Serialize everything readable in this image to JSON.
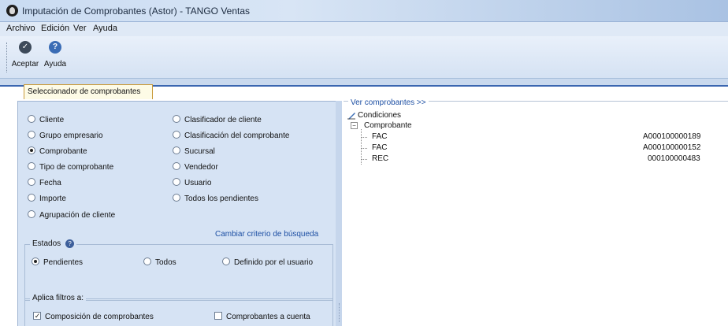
{
  "window": {
    "title": "Imputación de Comprobantes (Astor) - TANGO Ventas"
  },
  "menu": [
    "Archivo",
    "Edición",
    "Ver",
    "Ayuda"
  ],
  "toolbar": {
    "accept_label": "Aceptar",
    "help_label": "Ayuda"
  },
  "tab": {
    "label": "Seleccionador de comprobantes"
  },
  "criteria": {
    "left": [
      {
        "label": "Cliente",
        "selected": false
      },
      {
        "label": "Grupo empresario",
        "selected": false
      },
      {
        "label": "Comprobante",
        "selected": true
      },
      {
        "label": "Tipo de comprobante",
        "selected": false
      },
      {
        "label": "Fecha",
        "selected": false
      },
      {
        "label": "Importe",
        "selected": false
      },
      {
        "label": "Agrupación de cliente",
        "selected": false
      }
    ],
    "right": [
      {
        "label": "Clasificador de cliente",
        "selected": false
      },
      {
        "label": "Clasificación del comprobante",
        "selected": false
      },
      {
        "label": "Sucursal",
        "selected": false
      },
      {
        "label": "Vendedor",
        "selected": false
      },
      {
        "label": "Usuario",
        "selected": false
      },
      {
        "label": "Todos los pendientes",
        "selected": false
      }
    ],
    "change_link": "Cambiar criterio de búsqueda"
  },
  "estados": {
    "title": "Estados",
    "options": [
      {
        "label": "Pendientes",
        "selected": true
      },
      {
        "label": "Todos",
        "selected": false
      },
      {
        "label": "Definido por el usuario",
        "selected": false
      }
    ]
  },
  "filtros": {
    "title": "Aplica filtros a:",
    "options": [
      {
        "label": "Composición de comprobantes",
        "checked": true
      },
      {
        "label": "Comprobantes a cuenta",
        "checked": false
      }
    ]
  },
  "right_panel": {
    "header": "Ver comprobantes >>",
    "root": "Condiciones",
    "node": "Comprobante",
    "rows": [
      {
        "type": "FAC",
        "number": "A000100000189"
      },
      {
        "type": "FAC",
        "number": "A000100000152"
      },
      {
        "type": "REC",
        "number": "000100000483"
      }
    ]
  }
}
